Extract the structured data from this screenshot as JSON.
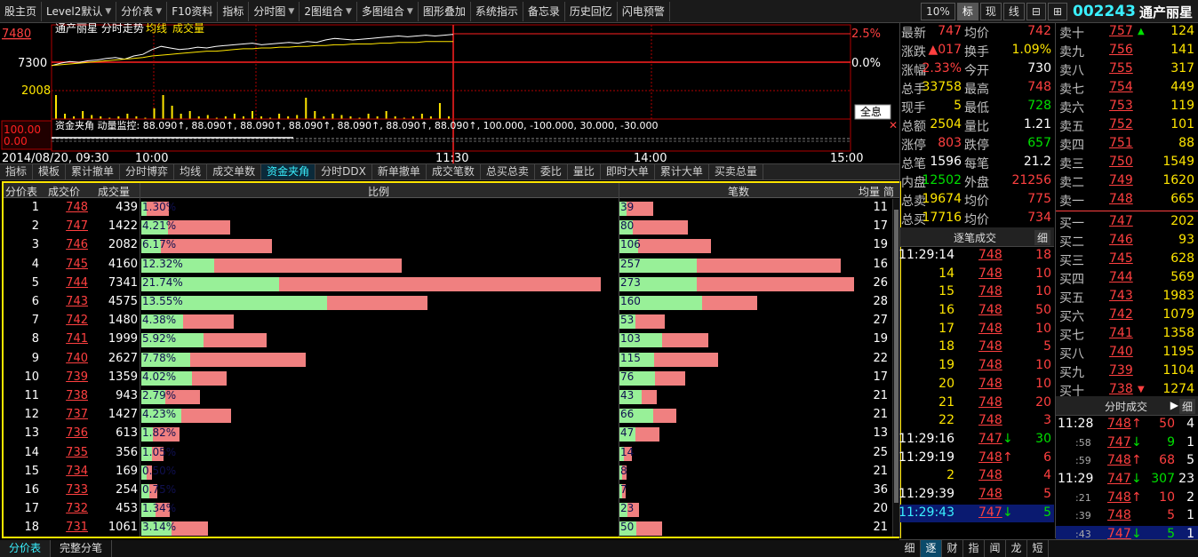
{
  "toolbar": {
    "items": [
      {
        "label": "股主页",
        "dropdown": false
      },
      {
        "label": "Level2默认",
        "dropdown": true
      },
      {
        "label": "分价表",
        "dropdown": true
      },
      {
        "label": "F10资料",
        "dropdown": false
      },
      {
        "label": "指标",
        "dropdown": false
      },
      {
        "label": "分时图",
        "dropdown": true
      },
      {
        "label": "2图组合",
        "dropdown": true
      },
      {
        "label": "多图组合",
        "dropdown": true
      },
      {
        "label": "图形叠加",
        "dropdown": false
      },
      {
        "label": "系统指示",
        "dropdown": false
      },
      {
        "label": "备忘录",
        "dropdown": false
      },
      {
        "label": "历史回忆",
        "dropdown": false
      },
      {
        "label": "闪电预警",
        "dropdown": false
      }
    ],
    "right_tabs": [
      "10%",
      "标",
      "现",
      "线"
    ],
    "active_right_tab": "标"
  },
  "stock": {
    "code": "002243",
    "name": "通产丽星"
  },
  "chart": {
    "title": "通产丽星 分时走势",
    "legend_avg": "均线",
    "legend_vol": "成交量",
    "price_labels": [
      "7480",
      "7300",
      "2008"
    ],
    "pct_labels": [
      "2.5%",
      "0.0%"
    ],
    "full_button": "全息",
    "indicator_line": "资金夹角  动量监控: 88.090↑, 88.090↑, 88.090↑, 88.090↑, 88.090↑, 88.090↑, 88.090↑, 100.000, -100.000, 30.000, -30.000",
    "ind_labels": [
      "100.00",
      "0.00"
    ],
    "time_labels": [
      "2014/08/20, 09:30",
      "10:00",
      "11:30",
      "14:00",
      "15:00"
    ],
    "price_line": [
      0.42,
      0.39,
      0.37,
      0.38,
      0.36,
      0.35,
      0.33,
      0.32,
      0.34,
      0.3,
      0.28,
      0.22,
      0.18,
      0.2,
      0.22,
      0.21,
      0.19,
      0.2,
      0.18,
      0.17,
      0.16,
      0.15,
      0.14,
      0.16,
      0.15,
      0.14,
      0.13,
      0.14,
      0.12,
      0.13,
      0.1,
      0.08,
      0.09,
      0.1,
      0.09,
      0.08,
      0.07,
      0.06,
      0.05,
      0.06,
      0.05,
      0.04,
      0.05,
      0.04,
      0.03
    ],
    "avg_line": [
      0.42,
      0.41,
      0.4,
      0.39,
      0.38,
      0.37,
      0.36,
      0.35,
      0.34,
      0.33,
      0.32,
      0.3,
      0.29,
      0.28,
      0.27,
      0.26,
      0.25,
      0.24,
      0.24,
      0.23,
      0.22,
      0.21,
      0.21,
      0.2,
      0.2,
      0.19,
      0.19,
      0.18,
      0.18,
      0.17,
      0.17,
      0.16,
      0.16,
      0.15,
      0.15,
      0.15,
      0.14,
      0.14,
      0.13,
      0.13,
      0.13,
      0.12,
      0.12,
      0.12,
      0.12
    ],
    "volume_bars": [
      0.9,
      0.2,
      0.1,
      0.3,
      0.15,
      0.1,
      0.05,
      0.1,
      0.2,
      0.1,
      0.05,
      0.4,
      0.9,
      0.5,
      0.2,
      0.3,
      0.1,
      0.15,
      0.05,
      0.1,
      0.2,
      0.1,
      0.3,
      0.1,
      0.05,
      0.2,
      0.1,
      0.15,
      0.8,
      0.3,
      0.1,
      0.2,
      0.15,
      0.1,
      0.05,
      0.2,
      0.1,
      0.3,
      0.1,
      0.05,
      0.1,
      0.2,
      0.1,
      0.6,
      0.1
    ]
  },
  "indicator_tabs": [
    "指标",
    "模板",
    "累计撤单",
    "分时博弈",
    "均线",
    "成交单数",
    "资金夹角",
    "分时DDX",
    "新单撤单",
    "成交笔数",
    "总买总卖",
    "委比",
    "量比",
    "即时大单",
    "累计大单",
    "买卖总量"
  ],
  "active_indicator_tab": "资金夹角",
  "table": {
    "headers": {
      "idx": "分价表",
      "price": "成交价",
      "volume": "成交量",
      "ratio": "比例",
      "count": "笔数",
      "avg": "均量",
      "brief": "简"
    },
    "rows": [
      {
        "idx": "1",
        "price": "748",
        "volume": "439",
        "pct": "1.30%",
        "ratio": 1.3,
        "green": 0.2,
        "count": "39",
        "count_val": 39,
        "count_green": 0.2,
        "avg": "11"
      },
      {
        "idx": "2",
        "price": "747",
        "volume": "1422",
        "pct": "4.21%",
        "ratio": 4.21,
        "green": 0.3,
        "count": "80",
        "count_val": 80,
        "count_green": 0.2,
        "avg": "17"
      },
      {
        "idx": "3",
        "price": "746",
        "volume": "2082",
        "pct": "6.17%",
        "ratio": 6.17,
        "green": 0.15,
        "count": "106",
        "count_val": 106,
        "count_green": 0.2,
        "avg": "19"
      },
      {
        "idx": "4",
        "price": "745",
        "volume": "4160",
        "pct": "12.32%",
        "ratio": 12.32,
        "green": 0.28,
        "count": "257",
        "count_val": 257,
        "count_green": 0.35,
        "avg": "16"
      },
      {
        "idx": "5",
        "price": "744",
        "volume": "7341",
        "pct": "21.74%",
        "ratio": 21.74,
        "green": 0.3,
        "count": "273",
        "count_val": 273,
        "count_green": 0.33,
        "avg": "26"
      },
      {
        "idx": "6",
        "price": "743",
        "volume": "4575",
        "pct": "13.55%",
        "ratio": 13.55,
        "green": 0.65,
        "count": "160",
        "count_val": 160,
        "count_green": 0.6,
        "avg": "28"
      },
      {
        "idx": "7",
        "price": "742",
        "volume": "1480",
        "pct": "4.38%",
        "ratio": 4.38,
        "green": 0.45,
        "count": "53",
        "count_val": 53,
        "count_green": 0.35,
        "avg": "27"
      },
      {
        "idx": "8",
        "price": "741",
        "volume": "1999",
        "pct": "5.92%",
        "ratio": 5.92,
        "green": 0.5,
        "count": "103",
        "count_val": 103,
        "count_green": 0.48,
        "avg": "19"
      },
      {
        "idx": "9",
        "price": "740",
        "volume": "2627",
        "pct": "7.78%",
        "ratio": 7.78,
        "green": 0.3,
        "count": "115",
        "count_val": 115,
        "count_green": 0.35,
        "avg": "22"
      },
      {
        "idx": "10",
        "price": "739",
        "volume": "1359",
        "pct": "4.02%",
        "ratio": 4.02,
        "green": 0.6,
        "count": "76",
        "count_val": 76,
        "count_green": 0.55,
        "avg": "17"
      },
      {
        "idx": "11",
        "price": "738",
        "volume": "943",
        "pct": "2.79%",
        "ratio": 2.79,
        "green": 0.4,
        "count": "43",
        "count_val": 43,
        "count_green": 0.6,
        "avg": "21"
      },
      {
        "idx": "12",
        "price": "737",
        "volume": "1427",
        "pct": "4.23%",
        "ratio": 4.23,
        "green": 0.45,
        "count": "66",
        "count_val": 66,
        "count_green": 0.6,
        "avg": "21"
      },
      {
        "idx": "13",
        "price": "736",
        "volume": "613",
        "pct": "1.82%",
        "ratio": 1.82,
        "green": 0.3,
        "count": "47",
        "count_val": 47,
        "count_green": 0.4,
        "avg": "13"
      },
      {
        "idx": "14",
        "price": "735",
        "volume": "356",
        "pct": "1.05%",
        "ratio": 1.05,
        "green": 0.5,
        "count": "14",
        "count_val": 14,
        "count_green": 0.4,
        "avg": "25"
      },
      {
        "idx": "15",
        "price": "734",
        "volume": "169",
        "pct": "0.50%",
        "ratio": 0.5,
        "green": 0.5,
        "count": "8",
        "count_val": 8,
        "count_green": 0.4,
        "avg": "21"
      },
      {
        "idx": "16",
        "price": "733",
        "volume": "254",
        "pct": "0.75%",
        "ratio": 0.75,
        "green": 0.5,
        "count": "7",
        "count_val": 7,
        "count_green": 0.4,
        "avg": "36"
      },
      {
        "idx": "17",
        "price": "732",
        "volume": "453",
        "pct": "1.34%",
        "ratio": 1.34,
        "green": 0.5,
        "count": "23",
        "count_val": 23,
        "count_green": 0.4,
        "avg": "20"
      },
      {
        "idx": "18",
        "price": "731",
        "volume": "1061",
        "pct": "3.14%",
        "ratio": 3.14,
        "green": 0.45,
        "count": "50",
        "count_val": 50,
        "count_green": 0.4,
        "avg": "21"
      }
    ]
  },
  "bottom_tabs": [
    "分价表",
    "完整分笔"
  ],
  "active_bottom_tab": "分价表",
  "quote": [
    {
      "l1": "最新",
      "v1": "747",
      "c1": "red",
      "l2": "均价",
      "v2": "742",
      "c2": "red"
    },
    {
      "l1": "涨跌",
      "v1": "▲017",
      "c1": "red",
      "l2": "换手",
      "v2": "1.09%",
      "c2": "yellow"
    },
    {
      "l1": "涨幅",
      "v1": "2.33%",
      "c1": "red",
      "l2": "今开",
      "v2": "730",
      "c2": "white"
    },
    {
      "l1": "总手",
      "v1": "33758",
      "c1": "yellow",
      "l2": "最高",
      "v2": "748",
      "c2": "red"
    },
    {
      "l1": "现手",
      "v1": "5",
      "c1": "yellow",
      "l2": "最低",
      "v2": "728",
      "c2": "green"
    },
    {
      "l1": "总额",
      "v1": "2504",
      "c1": "yellow",
      "l2": "量比",
      "v2": "1.21",
      "c2": "white"
    },
    {
      "l1": "涨停",
      "v1": "803",
      "c1": "red",
      "l2": "跌停",
      "v2": "657",
      "c2": "green"
    },
    {
      "l1": "总笔",
      "v1": "1596",
      "c1": "white",
      "l2": "每笔",
      "v2": "21.2",
      "c2": "white"
    },
    {
      "l1": "内盘",
      "v1": "12502",
      "c1": "green",
      "l2": "外盘",
      "v2": "21256",
      "c2": "red"
    },
    {
      "l1": "总卖",
      "v1": "19674",
      "c1": "yellow",
      "l2": "均价",
      "v2": "775",
      "c2": "red"
    },
    {
      "l1": "总买",
      "v1": "17716",
      "c1": "yellow",
      "l2": "均价",
      "v2": "734",
      "c2": "red"
    }
  ],
  "book": {
    "asks": [
      {
        "label": "卖十",
        "price": "757",
        "vol": "124",
        "arrow": "▲"
      },
      {
        "label": "卖九",
        "price": "756",
        "vol": "141",
        "arrow": ""
      },
      {
        "label": "卖八",
        "price": "755",
        "vol": "317",
        "arrow": ""
      },
      {
        "label": "卖七",
        "price": "754",
        "vol": "449",
        "arrow": ""
      },
      {
        "label": "卖六",
        "price": "753",
        "vol": "119",
        "arrow": ""
      },
      {
        "label": "卖五",
        "price": "752",
        "vol": "101",
        "arrow": ""
      },
      {
        "label": "卖四",
        "price": "751",
        "vol": "88",
        "arrow": ""
      },
      {
        "label": "卖三",
        "price": "750",
        "vol": "1549",
        "arrow": ""
      },
      {
        "label": "卖二",
        "price": "749",
        "vol": "1620",
        "arrow": ""
      },
      {
        "label": "卖一",
        "price": "748",
        "vol": "665",
        "arrow": ""
      }
    ],
    "bids": [
      {
        "label": "买一",
        "price": "747",
        "vol": "202",
        "arrow": ""
      },
      {
        "label": "买二",
        "price": "746",
        "vol": "93",
        "arrow": ""
      },
      {
        "label": "买三",
        "price": "745",
        "vol": "628",
        "arrow": ""
      },
      {
        "label": "买四",
        "price": "744",
        "vol": "569",
        "arrow": ""
      },
      {
        "label": "买五",
        "price": "743",
        "vol": "1983",
        "arrow": ""
      },
      {
        "label": "买六",
        "price": "742",
        "vol": "1079",
        "arrow": ""
      },
      {
        "label": "买七",
        "price": "741",
        "vol": "1358",
        "arrow": ""
      },
      {
        "label": "买八",
        "price": "740",
        "vol": "1195",
        "arrow": ""
      },
      {
        "label": "买九",
        "price": "739",
        "vol": "1104",
        "arrow": ""
      },
      {
        "label": "买十",
        "price": "738",
        "vol": "1274",
        "arrow": "▼"
      }
    ]
  },
  "ticks": {
    "header": "逐笔成交",
    "header_btn": "细",
    "rows": [
      {
        "time": "11:29:14",
        "price": "748",
        "dir": "",
        "vol": "18",
        "pc": "red",
        "vc": "red"
      },
      {
        "time": "14",
        "price": "748",
        "dir": "",
        "vol": "10",
        "pc": "red",
        "vc": "red"
      },
      {
        "time": "15",
        "price": "748",
        "dir": "",
        "vol": "10",
        "pc": "red",
        "vc": "red"
      },
      {
        "time": "16",
        "price": "748",
        "dir": "",
        "vol": "50",
        "pc": "red",
        "vc": "red"
      },
      {
        "time": "17",
        "price": "748",
        "dir": "",
        "vol": "10",
        "pc": "red",
        "vc": "red"
      },
      {
        "time": "18",
        "price": "748",
        "dir": "",
        "vol": "5",
        "pc": "red",
        "vc": "red"
      },
      {
        "time": "19",
        "price": "748",
        "dir": "",
        "vol": "10",
        "pc": "red",
        "vc": "red"
      },
      {
        "time": "20",
        "price": "748",
        "dir": "",
        "vol": "10",
        "pc": "red",
        "vc": "red"
      },
      {
        "time": "21",
        "price": "748",
        "dir": "",
        "vol": "20",
        "pc": "red",
        "vc": "red"
      },
      {
        "time": "22",
        "price": "748",
        "dir": "",
        "vol": "3",
        "pc": "red",
        "vc": "red"
      },
      {
        "time": "11:29:16",
        "price": "747",
        "dir": "↓",
        "vol": "30",
        "pc": "red",
        "vc": "green"
      },
      {
        "time": "11:29:19",
        "price": "748",
        "dir": "↑",
        "vol": "6",
        "pc": "red",
        "vc": "red"
      },
      {
        "time": "2",
        "price": "748",
        "dir": "",
        "vol": "4",
        "pc": "red",
        "vc": "red"
      },
      {
        "time": "11:29:39",
        "price": "748",
        "dir": "",
        "vol": "5",
        "pc": "red",
        "vc": "red"
      },
      {
        "time": "11:29:43",
        "price": "747",
        "dir": "↓",
        "vol": "5",
        "pc": "red",
        "vc": "green"
      }
    ]
  },
  "ticks2": {
    "header": "分时成交",
    "header_btn": "细",
    "rows": [
      {
        "time": "11:28",
        "price": "748",
        "dir": "↑",
        "vol": "50",
        "n": "4",
        "vc": "red"
      },
      {
        "time": ":58",
        "price": "747",
        "dir": "↓",
        "vol": "9",
        "n": "1",
        "vc": "green"
      },
      {
        "time": ":59",
        "price": "748",
        "dir": "↑",
        "vol": "68",
        "n": "5",
        "vc": "red"
      },
      {
        "time": "11:29",
        "price": "747",
        "dir": "↓",
        "vol": "307",
        "n": "23",
        "vc": "green"
      },
      {
        "time": ":21",
        "price": "748",
        "dir": "↑",
        "vol": "10",
        "n": "2",
        "vc": "red"
      },
      {
        "time": ":39",
        "price": "748",
        "dir": "",
        "vol": "5",
        "n": "1",
        "vc": "red"
      },
      {
        "time": ":43",
        "price": "747",
        "dir": "↓",
        "vol": "5",
        "n": "1",
        "vc": "green"
      }
    ]
  },
  "right_bottom_tabs": [
    "细",
    "逐",
    "财",
    "指",
    "闻",
    "龙",
    "短"
  ],
  "active_right_bottom_tab": "逐"
}
